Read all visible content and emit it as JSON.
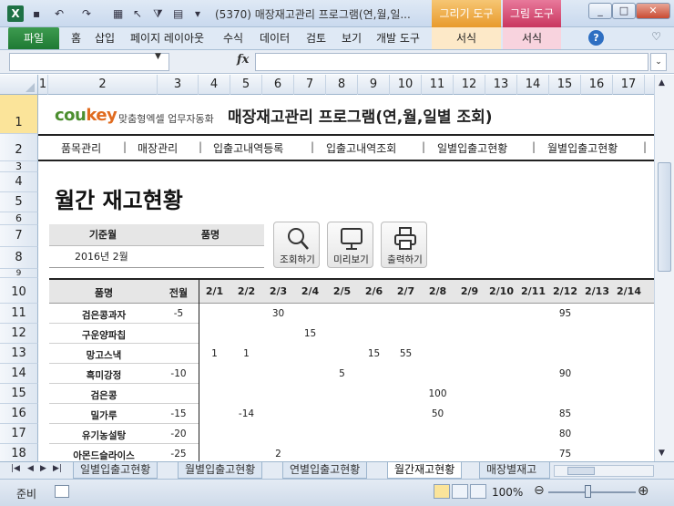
{
  "window": {
    "title": "(5370) 매장재고관리 프로그램(연,월,일...",
    "context_tab_1": "그리기 도구",
    "context_tab_2": "그림 도구"
  },
  "ribbon": {
    "tabs": [
      "파일",
      "홈",
      "삽입",
      "페이지 레이아웃",
      "수식",
      "데이터",
      "검토",
      "보기",
      "개발 도구",
      "서식",
      "서식"
    ]
  },
  "formula_bar": {
    "name_box": "",
    "fx": "fx",
    "formula": ""
  },
  "columns": [
    "1",
    "2",
    "3",
    "4",
    "5",
    "6",
    "7",
    "8",
    "9",
    "10",
    "11",
    "12",
    "13",
    "14",
    "15",
    "16",
    "17"
  ],
  "rows": [
    "1",
    "2",
    "3",
    "4",
    "5",
    "6",
    "7",
    "8",
    "9",
    "10",
    "11",
    "12",
    "13",
    "14",
    "15",
    "16",
    "17",
    "18"
  ],
  "sheet": {
    "logo_main": "cou",
    "logo_accent": "key",
    "logo_sub": "맞춤형엑셀 업무자동화",
    "program_title": "매장재고관리 프로그램(연,월,일별 조회)",
    "nav": [
      "품목관리",
      "매장관리",
      "입출고내역등록",
      "입출고내역조회",
      "일별입출고현황",
      "월별입출고현황"
    ],
    "heading": "월간 재고현황",
    "filter": {
      "label_base_month": "기준월",
      "label_item": "품명",
      "base_month": "2016년 2월",
      "item": ""
    },
    "buttons": {
      "search": "조회하기",
      "preview": "미리보기",
      "print": "출력하기"
    },
    "table": {
      "headers": {
        "item": "품명",
        "prev_month": "전월"
      },
      "dates": [
        "2/1",
        "2/2",
        "2/3",
        "2/4",
        "2/5",
        "2/6",
        "2/7",
        "2/8",
        "2/9",
        "2/10",
        "2/11",
        "2/12",
        "2/13",
        "2/14"
      ],
      "rows": [
        {
          "item": "검은콩과자",
          "prev": "-5",
          "values": [
            "",
            "",
            "30",
            "",
            "",
            "",
            "",
            "",
            "",
            "",
            "",
            "95",
            "",
            ""
          ]
        },
        {
          "item": "구운양파칩",
          "prev": "",
          "values": [
            "",
            "",
            "",
            "15",
            "",
            "",
            "",
            "",
            "",
            "",
            "",
            "",
            "",
            ""
          ]
        },
        {
          "item": "망고스낵",
          "prev": "",
          "values": [
            "1",
            "1",
            "",
            "",
            "",
            "15",
            "55",
            "",
            "",
            "",
            "",
            "",
            "",
            ""
          ]
        },
        {
          "item": "흑미강정",
          "prev": "-10",
          "values": [
            "",
            "",
            "",
            "",
            "5",
            "",
            "",
            "",
            "",
            "",
            "",
            "90",
            "",
            ""
          ]
        },
        {
          "item": "검은콩",
          "prev": "",
          "values": [
            "",
            "",
            "",
            "",
            "",
            "",
            "",
            "100",
            "",
            "",
            "",
            "",
            "",
            ""
          ]
        },
        {
          "item": "밀가루",
          "prev": "-15",
          "values": [
            "",
            "-14",
            "",
            "",
            "",
            "",
            "",
            "50",
            "",
            "",
            "",
            "85",
            "",
            ""
          ]
        },
        {
          "item": "유기농설탕",
          "prev": "-20",
          "values": [
            "",
            "",
            "",
            "",
            "",
            "",
            "",
            "",
            "",
            "",
            "",
            "80",
            "",
            ""
          ]
        },
        {
          "item": "아몬드슬라이스",
          "prev": "-25",
          "values": [
            "",
            "",
            "2",
            "",
            "",
            "",
            "",
            "",
            "",
            "",
            "",
            "75",
            "",
            ""
          ]
        }
      ]
    }
  },
  "sheet_tabs": [
    "일별입출고현황",
    "월별입출고현황",
    "연별입출고현황",
    "월간재고현황",
    "매장별재고"
  ],
  "active_sheet": "월간재고현황",
  "status": {
    "ready": "준비",
    "zoom": "100%"
  }
}
